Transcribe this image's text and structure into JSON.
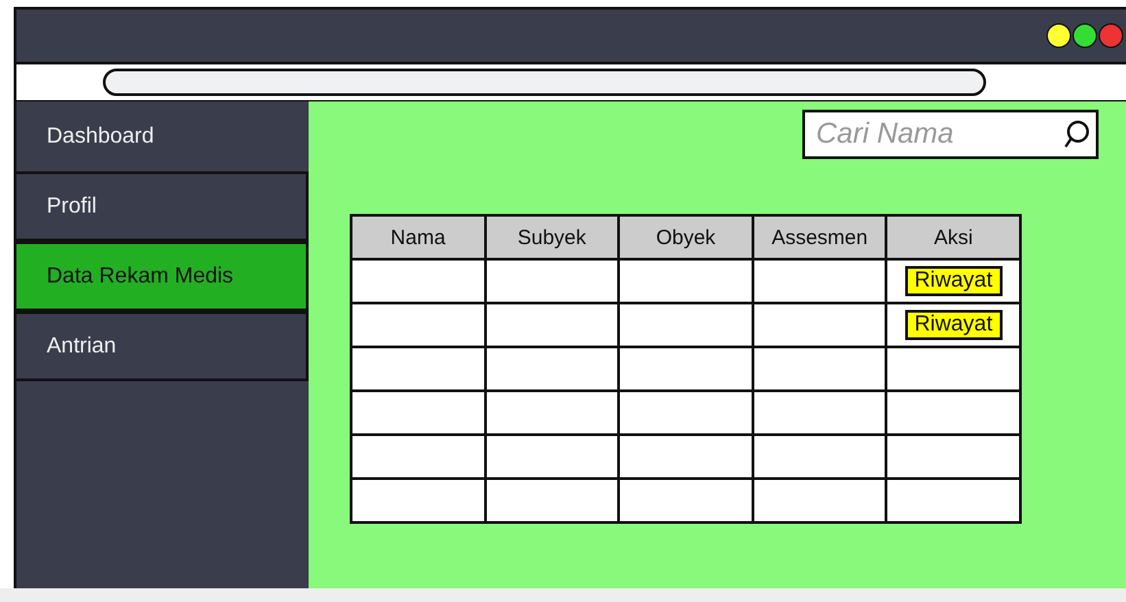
{
  "window": {
    "controls": [
      {
        "color": "#ffff33"
      },
      {
        "color": "#33dd33"
      },
      {
        "color": "#ee3333"
      }
    ]
  },
  "sidebar": {
    "items": [
      {
        "label": "Dashboard",
        "selected": false
      },
      {
        "label": "Profil",
        "selected": false
      },
      {
        "label": "Data Rekam Medis",
        "selected": true
      },
      {
        "label": "Antrian",
        "selected": false
      }
    ]
  },
  "search": {
    "placeholder": "Cari Nama"
  },
  "table": {
    "columns": [
      "Nama",
      "Subyek",
      "Obyek",
      "Assesmen",
      "Aksi"
    ],
    "rows": [
      {
        "kind": "action",
        "action": "Riwayat"
      },
      {
        "kind": "action",
        "action": "Riwayat"
      },
      {
        "kind": "blank"
      },
      {
        "kind": "blank"
      },
      {
        "kind": "blank"
      },
      {
        "kind": "blank"
      }
    ]
  }
}
